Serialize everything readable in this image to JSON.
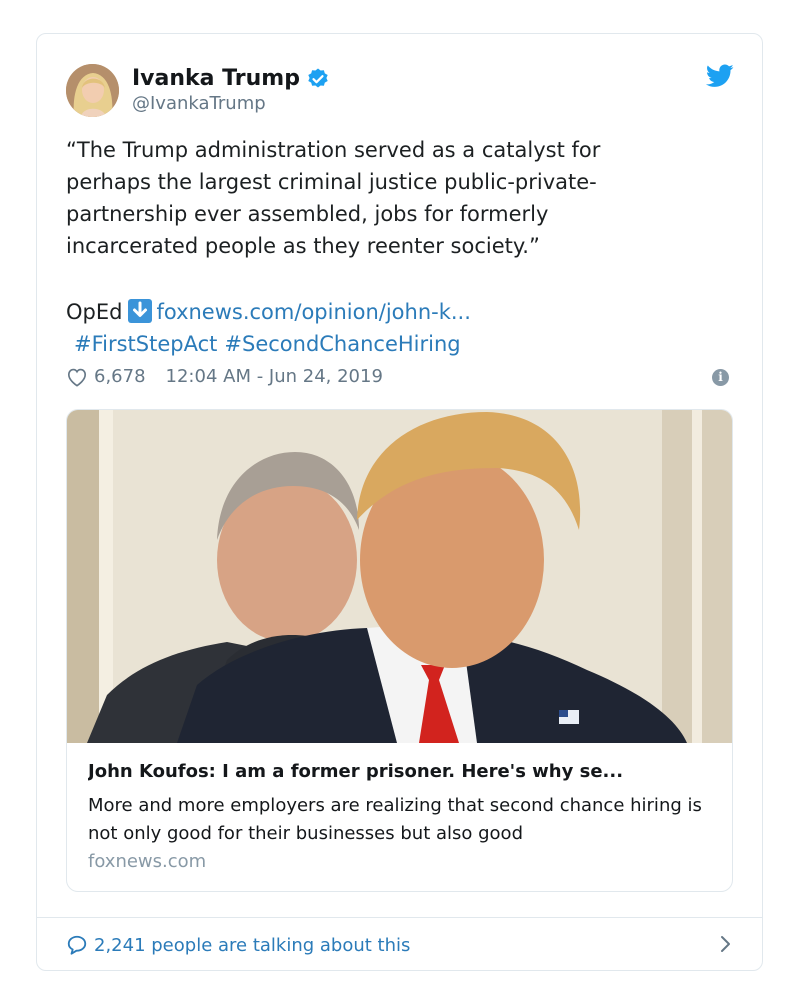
{
  "tweet": {
    "author_name": "Ivanka Trump",
    "author_handle": "@IvankaTrump",
    "text": "“The Trump administration served as a catalyst for\nperhaps the largest criminal justice public-private-\npartnership ever assembled, jobs for formerly\nincarcerated people as they reenter society.”",
    "link_prefix": "OpEd",
    "link_text": "foxnews.com/opinion/john-k...",
    "hashtags": [
      "#FirstStepAct",
      "#SecondChanceHiring"
    ],
    "likes": "6,678",
    "timestamp": "12:04 AM - Jun 24, 2019",
    "info_glyph": "i"
  },
  "link_card": {
    "title": "John Koufos: I am a former prisoner. Here's why se...",
    "description": "More and more employers are realizing that second chance hiring is not only good for their businesses but also good",
    "domain": "foxnews.com"
  },
  "footer": {
    "talking_text": "2,241 people are talking about this"
  },
  "colors": {
    "link": "#2b7bb9",
    "muted": "#657786",
    "verified": "#1da1f2",
    "border": "#e1e8ed"
  },
  "icons": [
    "twitter-bird-icon",
    "verified-badge-icon",
    "download-arrow-icon",
    "heart-icon",
    "info-icon",
    "speech-bubble-icon",
    "chevron-right-icon"
  ]
}
